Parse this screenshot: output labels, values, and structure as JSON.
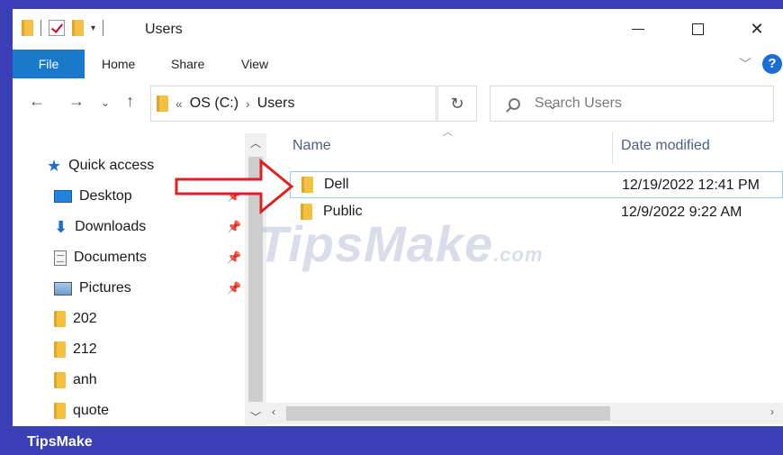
{
  "window": {
    "title": "Users"
  },
  "ribbon": {
    "tabs": [
      "File",
      "Home",
      "Share",
      "View"
    ]
  },
  "address": {
    "overflow": "«",
    "drive": "OS (C:)",
    "folder": "Users"
  },
  "search": {
    "placeholder": "Search Users"
  },
  "nav_pane": {
    "quick_access": "Quick access",
    "items": [
      {
        "label": "Desktop",
        "icon": "desktop-icon",
        "pinned": true
      },
      {
        "label": "Downloads",
        "icon": "download-icon",
        "pinned": true
      },
      {
        "label": "Documents",
        "icon": "document-icon",
        "pinned": true
      },
      {
        "label": "Pictures",
        "icon": "pictures-icon",
        "pinned": true
      },
      {
        "label": "202",
        "icon": "folder-icon",
        "pinned": false
      },
      {
        "label": "212",
        "icon": "folder-icon",
        "pinned": false
      },
      {
        "label": "anh",
        "icon": "folder-icon",
        "pinned": false
      },
      {
        "label": "quote",
        "icon": "folder-icon",
        "pinned": false
      }
    ]
  },
  "file_list": {
    "columns": [
      "Name",
      "Date modified"
    ],
    "rows": [
      {
        "name": "Dell",
        "date": "12/19/2022 12:41 PM",
        "selected": true
      },
      {
        "name": "Public",
        "date": "12/9/2022 9:22 AM",
        "selected": false
      }
    ]
  },
  "watermark": {
    "text": "TipsMake",
    "suffix": ".com"
  },
  "footer": {
    "brand": "TipsMake"
  },
  "colors": {
    "accent": "#1979ca",
    "frame": "#3a3fb8",
    "arrow": "#e02020"
  }
}
